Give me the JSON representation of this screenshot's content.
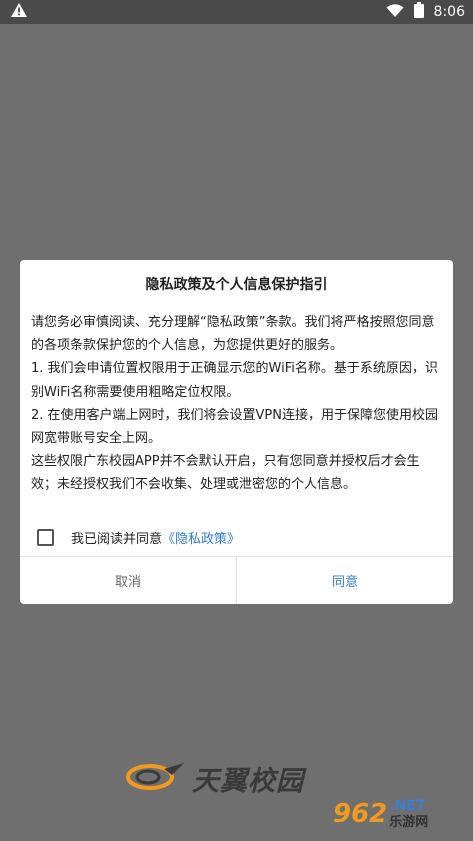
{
  "status_bar": {
    "time": "8:06",
    "icons": [
      "warning-icon",
      "wifi-icon",
      "battery-icon"
    ]
  },
  "dialog": {
    "title": "隐私政策及个人信息保护指引",
    "paragraphs": [
      "请您务必审慎阅读、充分理解“隐私政策”条款。我们将严格按照您同意的各项条款保护您的个人信息，为您提供更好的服务。",
      "1. 我们会申请位置权限用于正确显示您的WiFi名称。基于系统原因，识别WiFi名称需要使用粗略定位权限。",
      "2. 在使用客户端上网时，我们将会设置VPN连接，用于保障您使用校园网宽带账号安全上网。",
      "这些权限广东校园APP并不会默认开启，只有您同意并授权后才会生效；未经授权我们不会收集、处理或泄密您的个人信息。"
    ],
    "consent_text": "我已阅读并同意",
    "policy_link": "《隐私政策》",
    "checkbox_checked": false,
    "cancel_label": "取消",
    "agree_label": "同意"
  },
  "brand": {
    "name": "天翼校园"
  },
  "watermark": {
    "number": "962",
    "domain": ".NET",
    "name": "乐游网"
  },
  "colors": {
    "overlay": "#6f6f6f",
    "status_bar": "#4a4a4a",
    "link": "#2f7bd8",
    "brand_orange": "#f29a1f"
  }
}
